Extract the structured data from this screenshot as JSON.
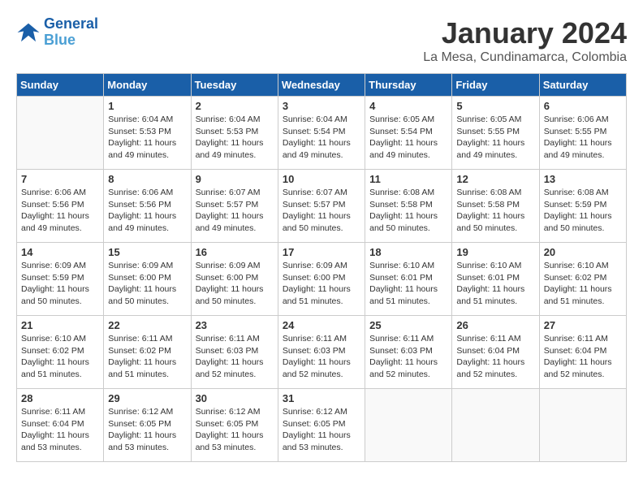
{
  "header": {
    "logo_line1": "General",
    "logo_line2": "Blue",
    "month_year": "January 2024",
    "location": "La Mesa, Cundinamarca, Colombia"
  },
  "weekdays": [
    "Sunday",
    "Monday",
    "Tuesday",
    "Wednesday",
    "Thursday",
    "Friday",
    "Saturday"
  ],
  "weeks": [
    [
      {
        "day": "",
        "info": ""
      },
      {
        "day": "1",
        "info": "Sunrise: 6:04 AM\nSunset: 5:53 PM\nDaylight: 11 hours\nand 49 minutes."
      },
      {
        "day": "2",
        "info": "Sunrise: 6:04 AM\nSunset: 5:53 PM\nDaylight: 11 hours\nand 49 minutes."
      },
      {
        "day": "3",
        "info": "Sunrise: 6:04 AM\nSunset: 5:54 PM\nDaylight: 11 hours\nand 49 minutes."
      },
      {
        "day": "4",
        "info": "Sunrise: 6:05 AM\nSunset: 5:54 PM\nDaylight: 11 hours\nand 49 minutes."
      },
      {
        "day": "5",
        "info": "Sunrise: 6:05 AM\nSunset: 5:55 PM\nDaylight: 11 hours\nand 49 minutes."
      },
      {
        "day": "6",
        "info": "Sunrise: 6:06 AM\nSunset: 5:55 PM\nDaylight: 11 hours\nand 49 minutes."
      }
    ],
    [
      {
        "day": "7",
        "info": "Sunrise: 6:06 AM\nSunset: 5:56 PM\nDaylight: 11 hours\nand 49 minutes."
      },
      {
        "day": "8",
        "info": "Sunrise: 6:06 AM\nSunset: 5:56 PM\nDaylight: 11 hours\nand 49 minutes."
      },
      {
        "day": "9",
        "info": "Sunrise: 6:07 AM\nSunset: 5:57 PM\nDaylight: 11 hours\nand 49 minutes."
      },
      {
        "day": "10",
        "info": "Sunrise: 6:07 AM\nSunset: 5:57 PM\nDaylight: 11 hours\nand 50 minutes."
      },
      {
        "day": "11",
        "info": "Sunrise: 6:08 AM\nSunset: 5:58 PM\nDaylight: 11 hours\nand 50 minutes."
      },
      {
        "day": "12",
        "info": "Sunrise: 6:08 AM\nSunset: 5:58 PM\nDaylight: 11 hours\nand 50 minutes."
      },
      {
        "day": "13",
        "info": "Sunrise: 6:08 AM\nSunset: 5:59 PM\nDaylight: 11 hours\nand 50 minutes."
      }
    ],
    [
      {
        "day": "14",
        "info": "Sunrise: 6:09 AM\nSunset: 5:59 PM\nDaylight: 11 hours\nand 50 minutes."
      },
      {
        "day": "15",
        "info": "Sunrise: 6:09 AM\nSunset: 6:00 PM\nDaylight: 11 hours\nand 50 minutes."
      },
      {
        "day": "16",
        "info": "Sunrise: 6:09 AM\nSunset: 6:00 PM\nDaylight: 11 hours\nand 50 minutes."
      },
      {
        "day": "17",
        "info": "Sunrise: 6:09 AM\nSunset: 6:00 PM\nDaylight: 11 hours\nand 51 minutes."
      },
      {
        "day": "18",
        "info": "Sunrise: 6:10 AM\nSunset: 6:01 PM\nDaylight: 11 hours\nand 51 minutes."
      },
      {
        "day": "19",
        "info": "Sunrise: 6:10 AM\nSunset: 6:01 PM\nDaylight: 11 hours\nand 51 minutes."
      },
      {
        "day": "20",
        "info": "Sunrise: 6:10 AM\nSunset: 6:02 PM\nDaylight: 11 hours\nand 51 minutes."
      }
    ],
    [
      {
        "day": "21",
        "info": "Sunrise: 6:10 AM\nSunset: 6:02 PM\nDaylight: 11 hours\nand 51 minutes."
      },
      {
        "day": "22",
        "info": "Sunrise: 6:11 AM\nSunset: 6:02 PM\nDaylight: 11 hours\nand 51 minutes."
      },
      {
        "day": "23",
        "info": "Sunrise: 6:11 AM\nSunset: 6:03 PM\nDaylight: 11 hours\nand 52 minutes."
      },
      {
        "day": "24",
        "info": "Sunrise: 6:11 AM\nSunset: 6:03 PM\nDaylight: 11 hours\nand 52 minutes."
      },
      {
        "day": "25",
        "info": "Sunrise: 6:11 AM\nSunset: 6:03 PM\nDaylight: 11 hours\nand 52 minutes."
      },
      {
        "day": "26",
        "info": "Sunrise: 6:11 AM\nSunset: 6:04 PM\nDaylight: 11 hours\nand 52 minutes."
      },
      {
        "day": "27",
        "info": "Sunrise: 6:11 AM\nSunset: 6:04 PM\nDaylight: 11 hours\nand 52 minutes."
      }
    ],
    [
      {
        "day": "28",
        "info": "Sunrise: 6:11 AM\nSunset: 6:04 PM\nDaylight: 11 hours\nand 53 minutes."
      },
      {
        "day": "29",
        "info": "Sunrise: 6:12 AM\nSunset: 6:05 PM\nDaylight: 11 hours\nand 53 minutes."
      },
      {
        "day": "30",
        "info": "Sunrise: 6:12 AM\nSunset: 6:05 PM\nDaylight: 11 hours\nand 53 minutes."
      },
      {
        "day": "31",
        "info": "Sunrise: 6:12 AM\nSunset: 6:05 PM\nDaylight: 11 hours\nand 53 minutes."
      },
      {
        "day": "",
        "info": ""
      },
      {
        "day": "",
        "info": ""
      },
      {
        "day": "",
        "info": ""
      }
    ]
  ]
}
